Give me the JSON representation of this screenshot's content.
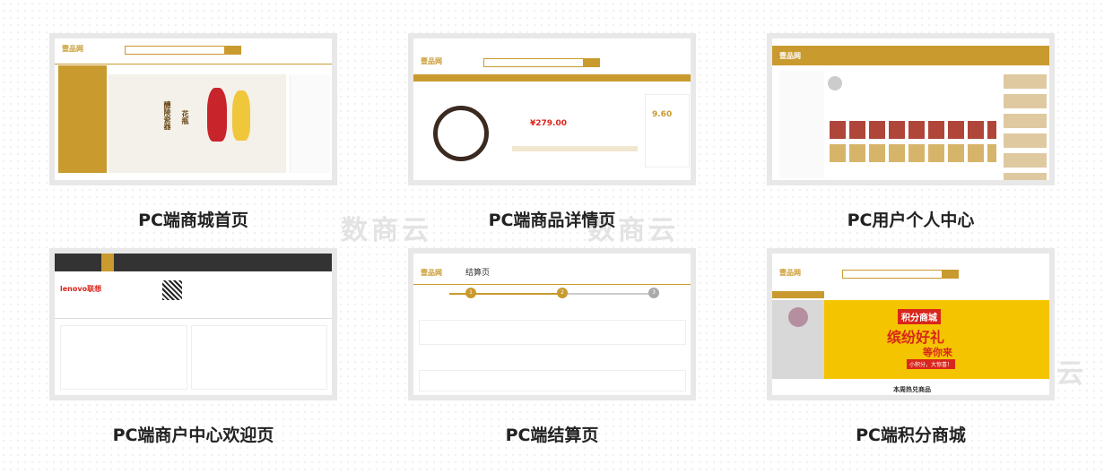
{
  "cards": [
    {
      "caption": "PC端商城首页",
      "logo": "壹品网",
      "banner_line1": "醴陵瓷器",
      "banner_line2": "花瓶"
    },
    {
      "caption": "PC端商品详情页",
      "logo": "壹品网",
      "price": "¥279.00",
      "side_price": "9.60"
    },
    {
      "caption": "PC用户个人中心",
      "logo": "壹品网"
    },
    {
      "caption": "PC端商户中心欢迎页",
      "logo": "lenovo联想"
    },
    {
      "caption": "PC端结算页",
      "logo": "壹品网",
      "title": "结算页",
      "steps": [
        "1",
        "2",
        "3"
      ]
    },
    {
      "caption": "PC端积分商城",
      "logo": "壹品网",
      "banner_line1": "积分商城",
      "banner_line2": "缤纷好礼",
      "banner_line3": "等你来",
      "banner_line4": "小积分，大惊喜！",
      "section": "本周热兑商品"
    }
  ],
  "watermark": "数商云",
  "colors": {
    "accent": "#c99a2e",
    "banner_yellow": "#f5c400"
  }
}
